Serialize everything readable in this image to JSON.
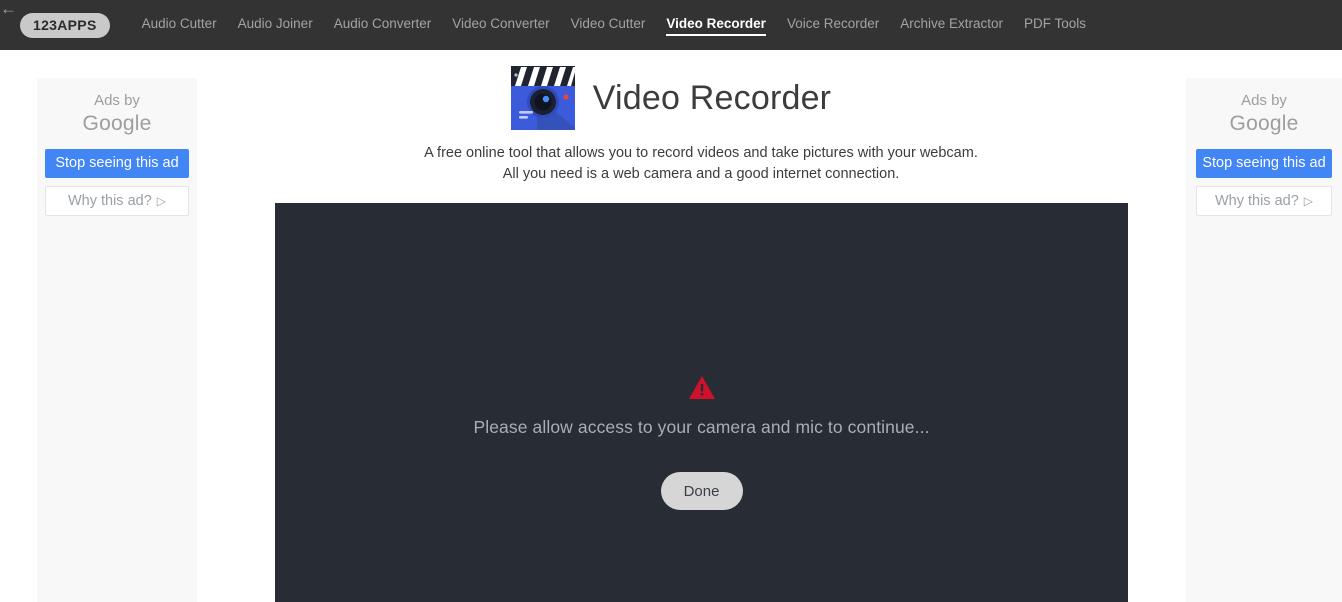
{
  "header": {
    "logo": "123APPS",
    "nav": [
      {
        "label": "Audio Cutter",
        "active": false
      },
      {
        "label": "Audio Joiner",
        "active": false
      },
      {
        "label": "Audio Converter",
        "active": false
      },
      {
        "label": "Video Converter",
        "active": false
      },
      {
        "label": "Video Cutter",
        "active": false
      },
      {
        "label": "Video Recorder",
        "active": true
      },
      {
        "label": "Voice Recorder",
        "active": false
      },
      {
        "label": "Archive Extractor",
        "active": false
      },
      {
        "label": "PDF Tools",
        "active": false
      }
    ],
    "background_color": "#333333",
    "active_color": "#ffffff",
    "inactive_color": "#a3a3a3"
  },
  "main": {
    "icon_name": "video-recorder-app-icon",
    "title": "Video Recorder",
    "subtitle": "A free online tool that allows you to record videos and take pictures with your webcam. All you need is a web camera and a good internet connection."
  },
  "stage": {
    "warning_icon_name": "warning-triangle-icon",
    "warning_color": "#d0112b",
    "message": "Please allow access to your camera and mic to continue...",
    "done_label": "Done",
    "background_color": "#282c34"
  },
  "ads": {
    "left": {
      "back_arrow": "←",
      "ads_by": "Ads by",
      "brand": "Google",
      "stop_label": "Stop seeing this ad",
      "why_label": "Why this ad?",
      "why_glyph": "▷",
      "button_color": "#4285f4"
    },
    "right": {
      "back_arrow": "←",
      "ads_by": "Ads by",
      "brand": "Google",
      "stop_label": "Stop seeing this ad",
      "why_label": "Why this ad?",
      "why_glyph": "▷",
      "button_color": "#4285f4"
    }
  }
}
